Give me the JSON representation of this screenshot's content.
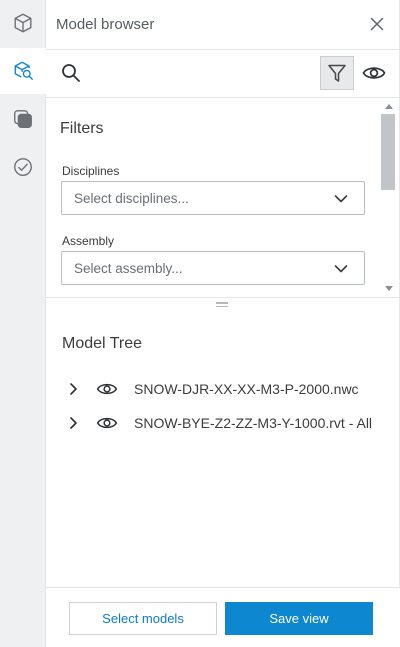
{
  "rail": {
    "items": [
      {
        "icon": "cube-icon"
      },
      {
        "icon": "model-search-icon",
        "active": true
      },
      {
        "icon": "layers-icon"
      },
      {
        "icon": "check-circle-icon"
      }
    ]
  },
  "panel": {
    "title": "Model browser",
    "close_icon": "close-icon"
  },
  "toolbar": {
    "search_icon": "search-icon",
    "filter_icon": "filter-icon",
    "eye_icon": "eye-icon"
  },
  "filters": {
    "heading": "Filters",
    "disciplines": {
      "label": "Disciplines",
      "placeholder": "Select disciplines..."
    },
    "assembly": {
      "label": "Assembly",
      "placeholder": "Select assembly..."
    }
  },
  "tree": {
    "heading": "Model Tree",
    "items": [
      {
        "label": "SNOW-DJR-XX-XX-M3-P-2000.nwc"
      },
      {
        "label": "SNOW-BYE-Z2-ZZ-M3-Y-1000.rvt - All"
      }
    ]
  },
  "footer": {
    "select_models": "Select models",
    "save_view": "Save view"
  },
  "colors": {
    "accent": "#0d87cf",
    "link": "#0b7cbf",
    "rail_bg": "#eef0f2"
  }
}
